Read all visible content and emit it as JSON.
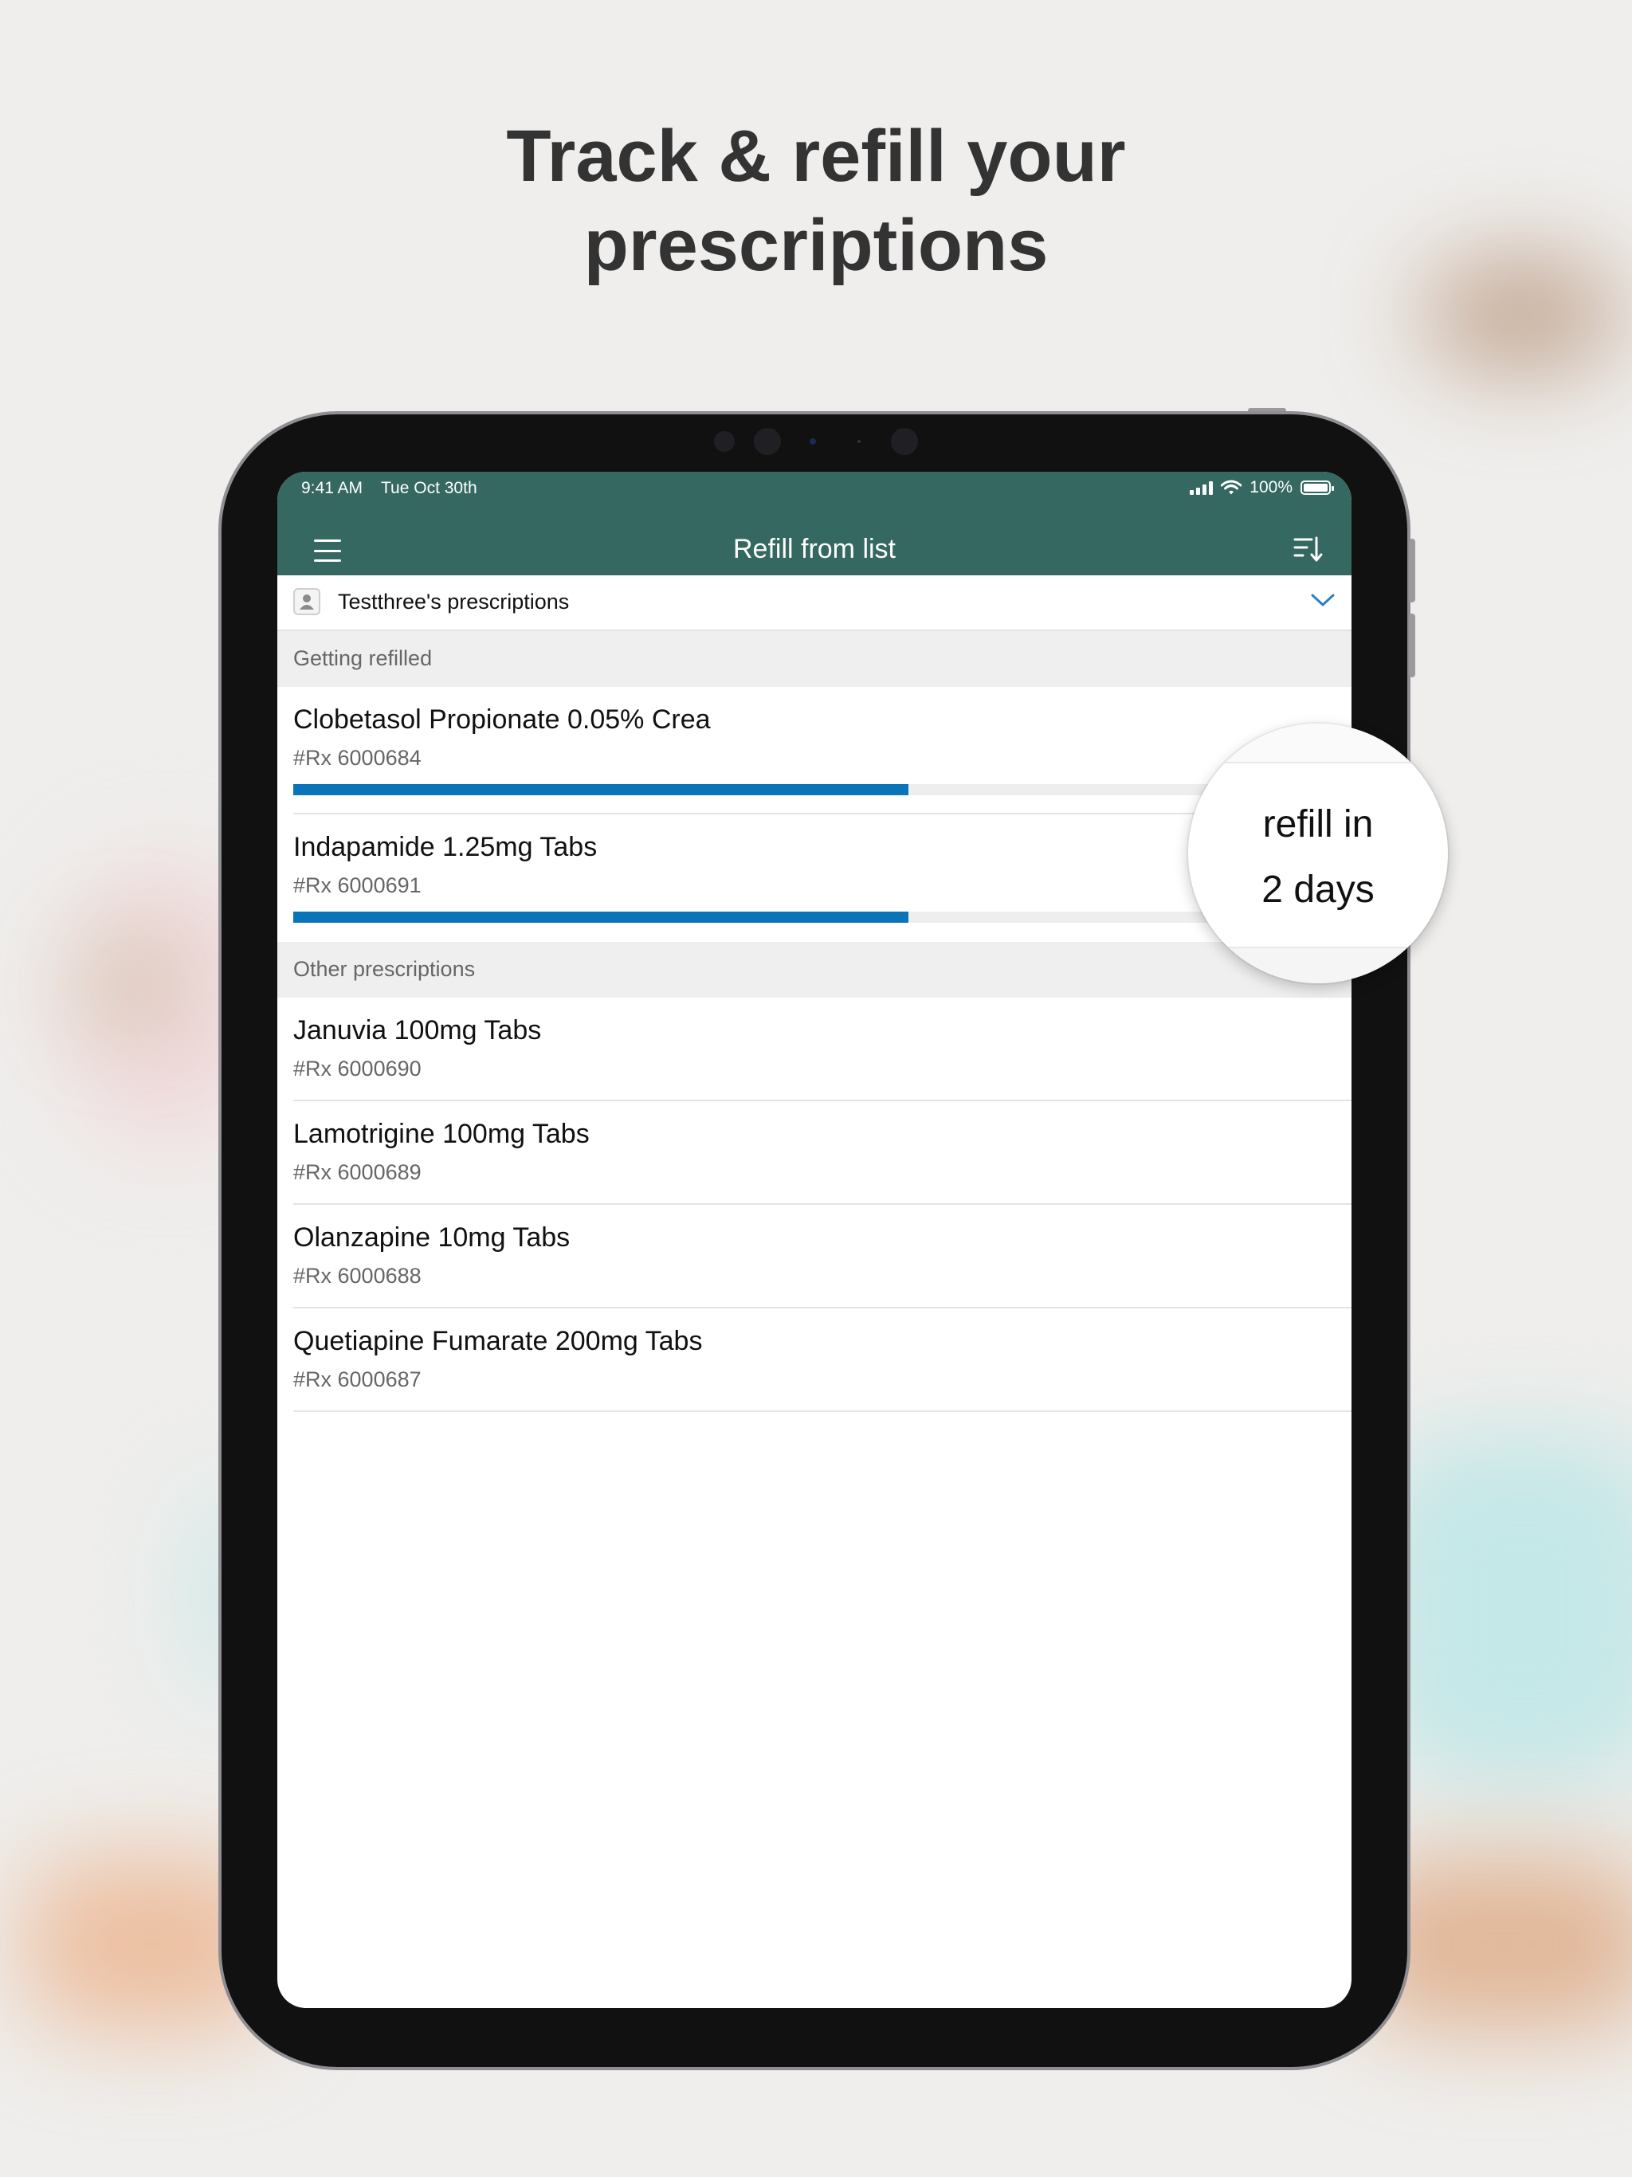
{
  "headline": {
    "line1": "Track & refill your",
    "line2": "prescriptions"
  },
  "statusbar": {
    "time": "9:41 AM",
    "date": "Tue Oct 30th",
    "battery": "100%"
  },
  "navbar": {
    "title": "Refill from list",
    "menu_icon": "hamburger-icon",
    "sort_icon": "sort-icon"
  },
  "profile_selector": {
    "label": "Testthree's prescriptions",
    "icon": "person-icon",
    "chevron": "chevron-down-icon"
  },
  "sections": {
    "getting_refilled": {
      "title": "Getting refilled",
      "items": [
        {
          "name": "Clobetasol Propionate 0.05% Crea",
          "rx": "#Rx 6000684",
          "progress": 0.59
        },
        {
          "name": "Indapamide 1.25mg Tabs",
          "rx": "#Rx 6000691",
          "progress": 0.59
        }
      ]
    },
    "other": {
      "title": "Other prescriptions",
      "items": [
        {
          "name": "Januvia 100mg Tabs",
          "rx": "#Rx 6000690"
        },
        {
          "name": "Lamotrigine 100mg Tabs",
          "rx": "#Rx 6000689"
        },
        {
          "name": "Olanzapine 10mg Tabs",
          "rx": "#Rx 6000688"
        },
        {
          "name": "Quetiapine Fumarate 200mg Tabs",
          "rx": "#Rx 6000687"
        }
      ]
    }
  },
  "callout": {
    "line1": "refill in",
    "line2": "2 days"
  },
  "colors": {
    "navbar": "#346860",
    "progress": "#0a74b9",
    "chevron": "#2c7fc4"
  }
}
